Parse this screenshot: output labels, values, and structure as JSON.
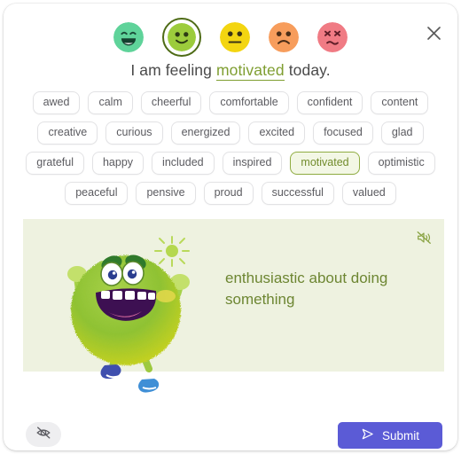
{
  "dialog": {
    "close_icon": "close-icon"
  },
  "moods": [
    {
      "id": "mood-very-happy",
      "icon": "smiling-face-closed-eyes-icon",
      "color": "#5fd39a",
      "selected": false
    },
    {
      "id": "mood-happy",
      "icon": "smiling-face-icon",
      "color": "#9ccc3c",
      "selected": true
    },
    {
      "id": "mood-neutral",
      "icon": "neutral-face-icon",
      "color": "#f3d511",
      "selected": false
    },
    {
      "id": "mood-sad",
      "icon": "frowning-face-icon",
      "color": "#f79d5c",
      "selected": false
    },
    {
      "id": "mood-distressed",
      "icon": "confounded-face-icon",
      "color": "#f07b84",
      "selected": false
    }
  ],
  "sentence": {
    "prefix": "I am feeling ",
    "word": "motivated",
    "suffix": " today."
  },
  "chips": [
    {
      "label": "awed",
      "selected": false
    },
    {
      "label": "calm",
      "selected": false
    },
    {
      "label": "cheerful",
      "selected": false
    },
    {
      "label": "comfortable",
      "selected": false
    },
    {
      "label": "confident",
      "selected": false
    },
    {
      "label": "content",
      "selected": false
    },
    {
      "label": "creative",
      "selected": false
    },
    {
      "label": "curious",
      "selected": false
    },
    {
      "label": "energized",
      "selected": false
    },
    {
      "label": "excited",
      "selected": false
    },
    {
      "label": "focused",
      "selected": false
    },
    {
      "label": "glad",
      "selected": false
    },
    {
      "label": "grateful",
      "selected": false
    },
    {
      "label": "happy",
      "selected": false
    },
    {
      "label": "included",
      "selected": false
    },
    {
      "label": "inspired",
      "selected": false
    },
    {
      "label": "motivated",
      "selected": true
    },
    {
      "label": "optimistic",
      "selected": false
    },
    {
      "label": "peaceful",
      "selected": false
    },
    {
      "label": "pensive",
      "selected": false
    },
    {
      "label": "proud",
      "selected": false
    },
    {
      "label": "successful",
      "selected": false
    },
    {
      "label": "valued",
      "selected": false
    }
  ],
  "panel": {
    "definition": "enthusiastic about doing something",
    "speaker_icon": "speaker-muted-icon",
    "illustration": "green-monster-character",
    "background_color": "#eef2e0",
    "text_color": "#6d8632"
  },
  "footer": {
    "hide_icon": "eye-slash-icon",
    "submit_label": "Submit",
    "submit_icon": "send-icon",
    "submit_color": "#5b5bd6"
  }
}
